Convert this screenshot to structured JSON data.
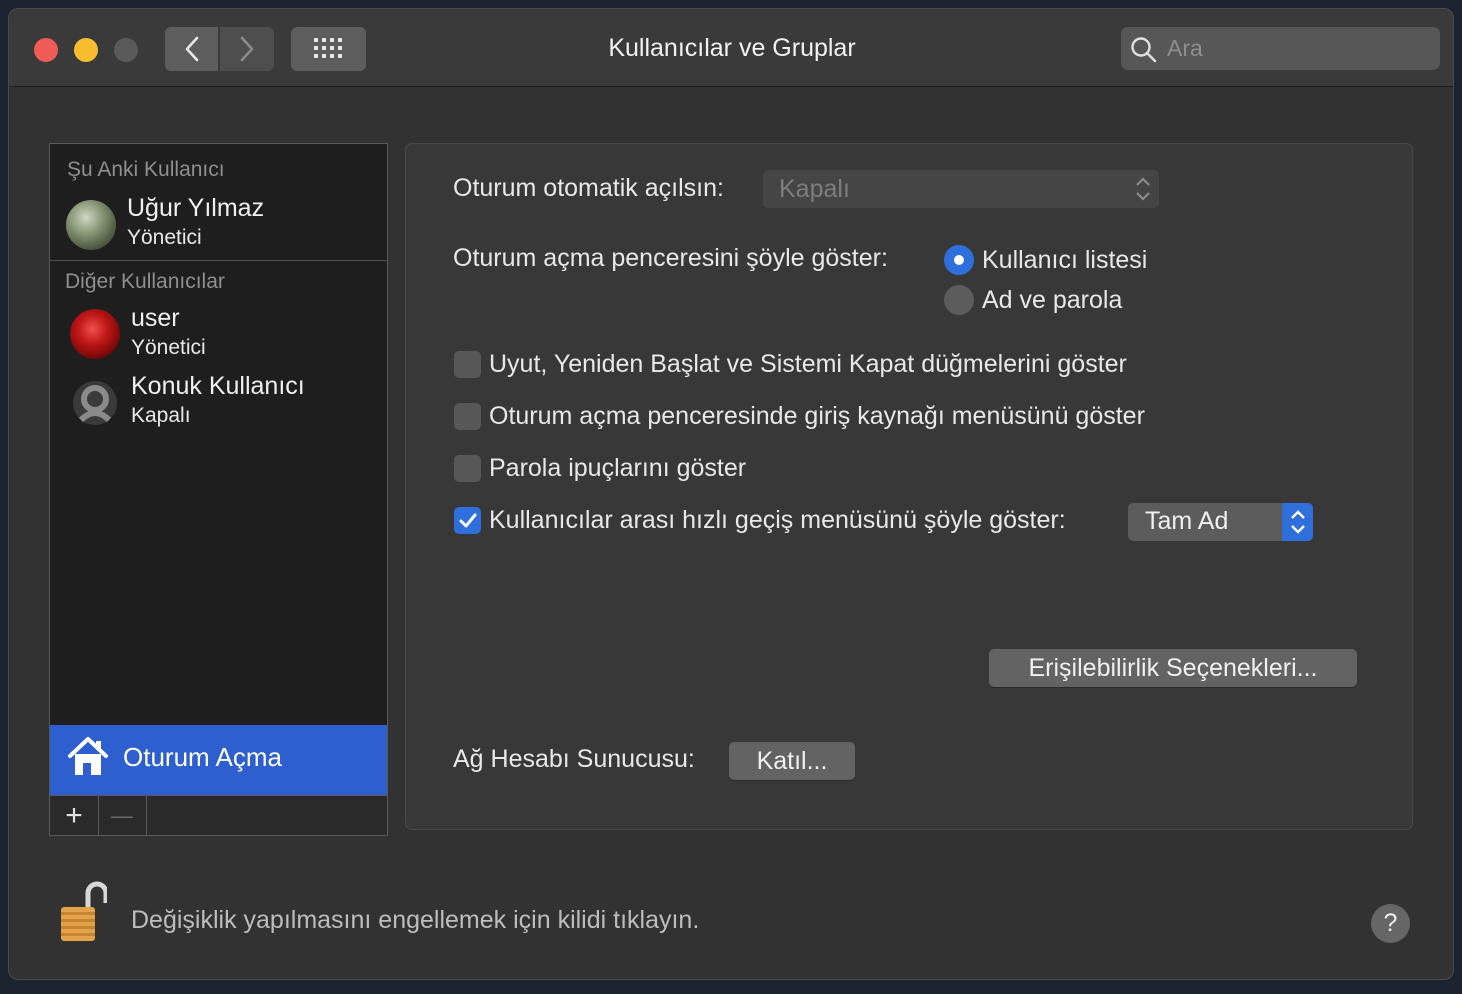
{
  "window": {
    "title": "Kullanıcılar ve Gruplar"
  },
  "toolbar": {
    "search_placeholder": "Ara"
  },
  "sidebar": {
    "current_header": "Şu Anki Kullanıcı",
    "current_user": {
      "name": "Uğur Yılmaz",
      "role": "Yönetici"
    },
    "other_header": "Diğer Kullanıcılar",
    "other_users": [
      {
        "name": "user",
        "role": "Yönetici"
      },
      {
        "name": "Konuk Kullanıcı",
        "role": "Kapalı"
      }
    ],
    "login_options_label": "Oturum Açma",
    "add_label": "+",
    "remove_label": "—"
  },
  "main": {
    "auto_login_label": "Oturum otomatik açılsın:",
    "auto_login_value": "Kapalı",
    "display_login_label": "Oturum açma penceresini şöyle göster:",
    "radio_options": [
      {
        "label": "Kullanıcı listesi",
        "selected": true
      },
      {
        "label": "Ad ve parola",
        "selected": false
      }
    ],
    "checkboxes": [
      {
        "label": "Uyut, Yeniden Başlat ve Sistemi Kapat düğmelerini göster",
        "checked": false
      },
      {
        "label": "Oturum açma penceresinde giriş kaynağı menüsünü göster",
        "checked": false
      },
      {
        "label": "Parola ipuçlarını göster",
        "checked": false
      },
      {
        "label": "Kullanıcılar arası hızlı geçiş menüsünü şöyle göster:",
        "checked": true
      }
    ],
    "fast_switch_value": "Tam Ad",
    "accessibility_button": "Erişilebilirlik Seçenekleri...",
    "network_server_label": "Ağ Hesabı Sunucusu:",
    "join_button": "Katıl..."
  },
  "footer": {
    "lock_text": "Değişiklik yapılmasını engellemek için kilidi tıklayın.",
    "help_label": "?"
  },
  "colors": {
    "accent": "#2f6fdc",
    "selection": "#2d5fce",
    "window_bg": "#323232"
  }
}
